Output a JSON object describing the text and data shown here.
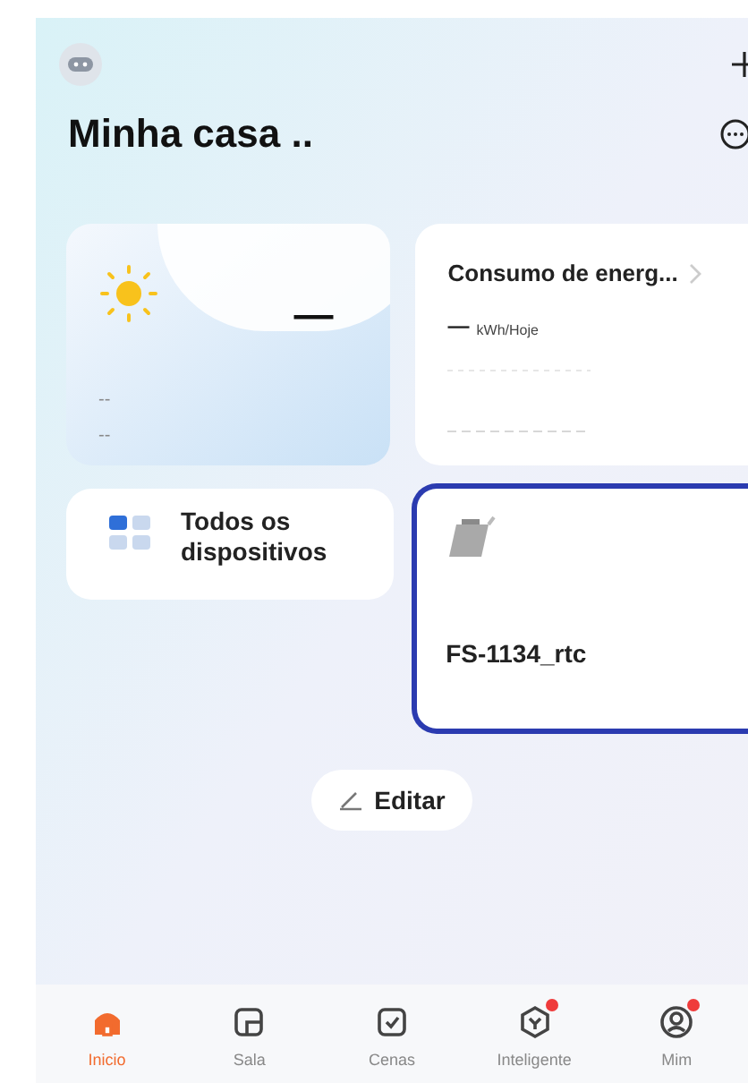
{
  "header": {
    "title": "Minha casa .."
  },
  "weather": {
    "temperature": "—",
    "line_1": "--",
    "line_2": "--"
  },
  "energy": {
    "title": "Consumo de energ...",
    "value": "—",
    "unit": "kWh/Hoje"
  },
  "all_devices": {
    "label": "Todos os dispositivos"
  },
  "devices": [
    {
      "name": "FS-1134_rtc",
      "selected": true
    }
  ],
  "edit_button": {
    "label": "Editar"
  },
  "tabs": [
    {
      "label": "Inicio",
      "selected": true,
      "badge": false,
      "kind": "home"
    },
    {
      "label": "Sala",
      "selected": false,
      "badge": false,
      "kind": "room"
    },
    {
      "label": "Cenas",
      "selected": false,
      "badge": false,
      "kind": "scene"
    },
    {
      "label": "Inteligente",
      "selected": false,
      "badge": true,
      "kind": "smart"
    },
    {
      "label": "Mim",
      "selected": false,
      "badge": true,
      "kind": "me"
    }
  ]
}
